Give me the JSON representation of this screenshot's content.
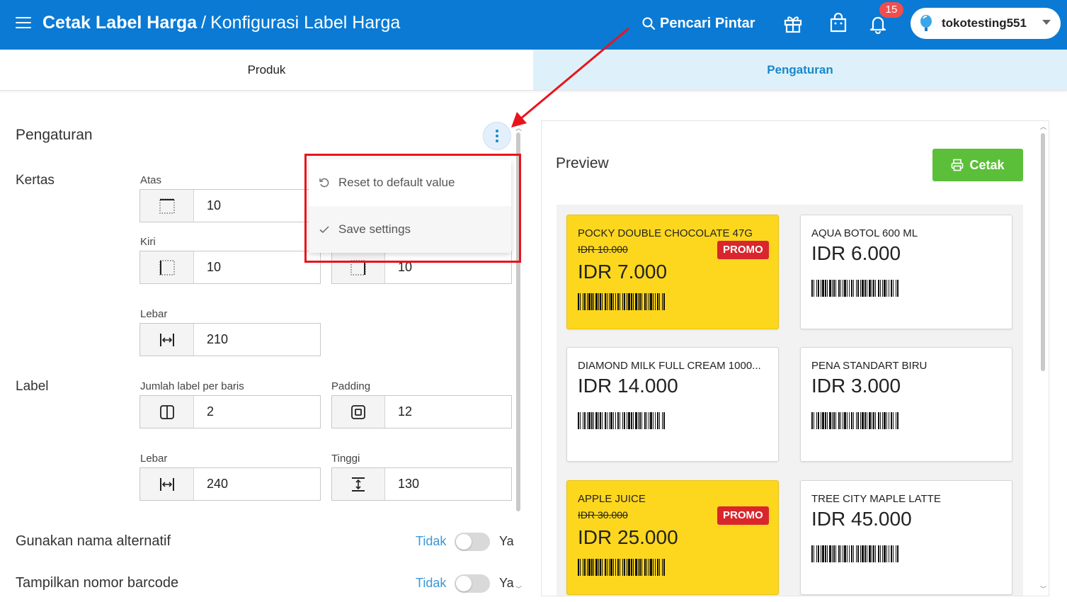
{
  "header": {
    "title_main": "Cetak Label Harga",
    "title_separator": "/",
    "title_sub": "Konfigurasi Label Harga",
    "smart_search": "Pencari Pintar",
    "notification_count": "15",
    "store_name": "tokotesting551",
    "bg_color": "#0a7ad4"
  },
  "tabs": [
    {
      "label": "Produk",
      "active": false
    },
    {
      "label": "Pengaturan",
      "active": true
    }
  ],
  "settings": {
    "title": "Pengaturan",
    "paper": {
      "section": "Kertas",
      "top_label": "Atas",
      "top_value": "10",
      "left_label": "Kiri",
      "left_value": "10",
      "right_value": "10",
      "width_label": "Lebar",
      "width_value": "210"
    },
    "label": {
      "section": "Label",
      "per_row_label": "Jumlah label per baris",
      "per_row_value": "2",
      "padding_label": "Padding",
      "padding_value": "12",
      "width_label": "Lebar",
      "width_value": "240",
      "height_label": "Tinggi",
      "height_value": "130"
    },
    "toggles": [
      {
        "label": "Gunakan nama alternatif",
        "off": "Tidak",
        "on": "Ya",
        "value": false
      },
      {
        "label": "Tampilkan nomor barcode",
        "off": "Tidak",
        "on": "Ya",
        "value": false
      }
    ]
  },
  "menu": {
    "items": [
      {
        "label": "Reset to default value",
        "icon": "reset-icon"
      },
      {
        "label": "Save settings",
        "icon": "check-icon"
      }
    ]
  },
  "preview": {
    "title": "Preview",
    "print_label": "Cetak",
    "print_color": "#5cbf3a",
    "promo_color": "#fdd71e",
    "labels": [
      {
        "name": "POCKY DOUBLE CHOCOLATE 47G",
        "old_price": "IDR 10.000",
        "price": "IDR 7.000",
        "promo": "PROMO"
      },
      {
        "name": "AQUA BOTOL 600 ML",
        "price": "IDR 6.000"
      },
      {
        "name": "DIAMOND MILK FULL CREAM 1000...",
        "price": "IDR 14.000"
      },
      {
        "name": "PENA STANDART BIRU",
        "price": "IDR 3.000"
      },
      {
        "name": "APPLE JUICE",
        "old_price": "IDR 30.000",
        "price": "IDR 25.000",
        "promo": "PROMO"
      },
      {
        "name": "TREE CITY MAPLE LATTE",
        "price": "IDR 45.000"
      }
    ]
  }
}
